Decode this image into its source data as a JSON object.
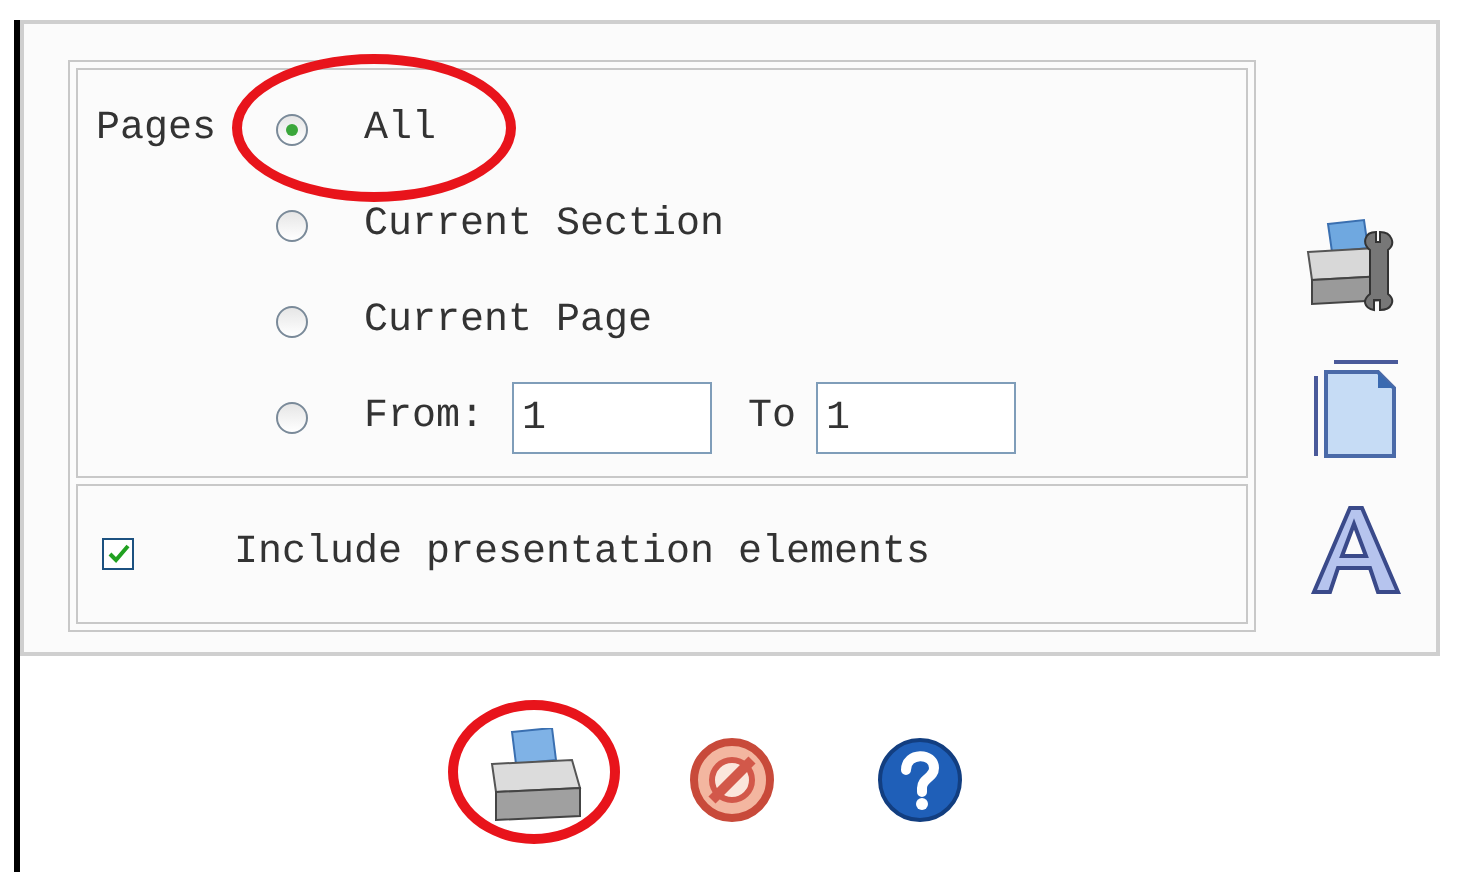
{
  "pages": {
    "label": "Pages",
    "options": [
      {
        "kind": "plain",
        "label": "All",
        "selected": true,
        "highlighted": true
      },
      {
        "kind": "plain",
        "label": "Current Section",
        "selected": false,
        "highlighted": false
      },
      {
        "kind": "plain",
        "label": "Current Page",
        "selected": false,
        "highlighted": false
      },
      {
        "kind": "range",
        "label": "From:",
        "selected": false,
        "highlighted": false,
        "from_value": "1",
        "to_label": "To",
        "to_value": "1"
      }
    ]
  },
  "include_presentation": {
    "label": "Include presentation elements",
    "checked": true
  },
  "side_tools": [
    {
      "kind": "printer-setup"
    },
    {
      "kind": "page-size"
    },
    {
      "kind": "font"
    }
  ],
  "buttons": [
    {
      "kind": "print",
      "highlighted": true
    },
    {
      "kind": "cancel",
      "highlighted": false
    },
    {
      "kind": "help",
      "highlighted": false
    }
  ]
}
